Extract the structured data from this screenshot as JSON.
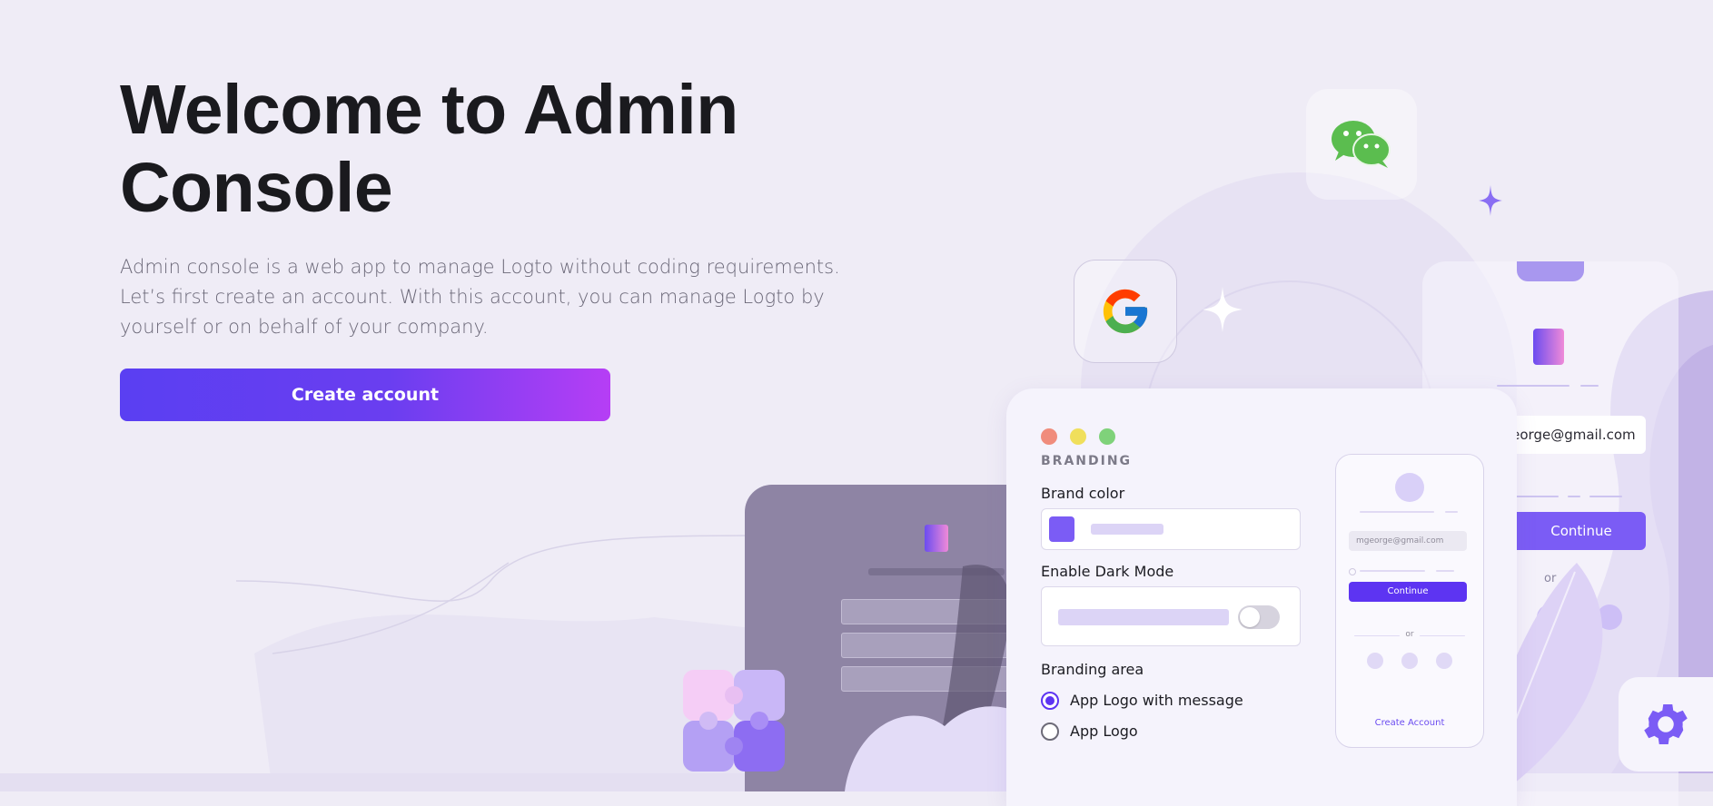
{
  "hero": {
    "title": "Welcome to Admin Console",
    "description": "Admin console is a web app to manage Logto without coding requirements. Let’s first create an account. With this account, you can manage Logto by yourself or on behalf of your company.",
    "cta_label": "Create account"
  },
  "illustration": {
    "window": {
      "section_caption": "BRANDING",
      "brand_color_label": "Brand color",
      "dark_mode_label": "Enable Dark Mode",
      "branding_area_label": "Branding area",
      "options": [
        {
          "label": "App Logo with message",
          "selected": true
        },
        {
          "label": "App Logo",
          "selected": false
        }
      ],
      "dark_mode_enabled": false
    },
    "phone": {
      "email": "mgeorge@gmail.com",
      "continue": "Continue",
      "or": "or",
      "create_account": "Create Account"
    },
    "background_phone": {
      "email": "mgeorge@gmail.com",
      "continue": "Continue",
      "or": "or"
    },
    "icons": [
      "wechat-icon",
      "google-icon",
      "gear-icon",
      "puzzle-icon",
      "sparkle-icon",
      "door-logo-icon"
    ]
  },
  "colors": {
    "accent": "#5d34f2",
    "gradient_end": "#b63ef5",
    "background": "#efecf6"
  }
}
